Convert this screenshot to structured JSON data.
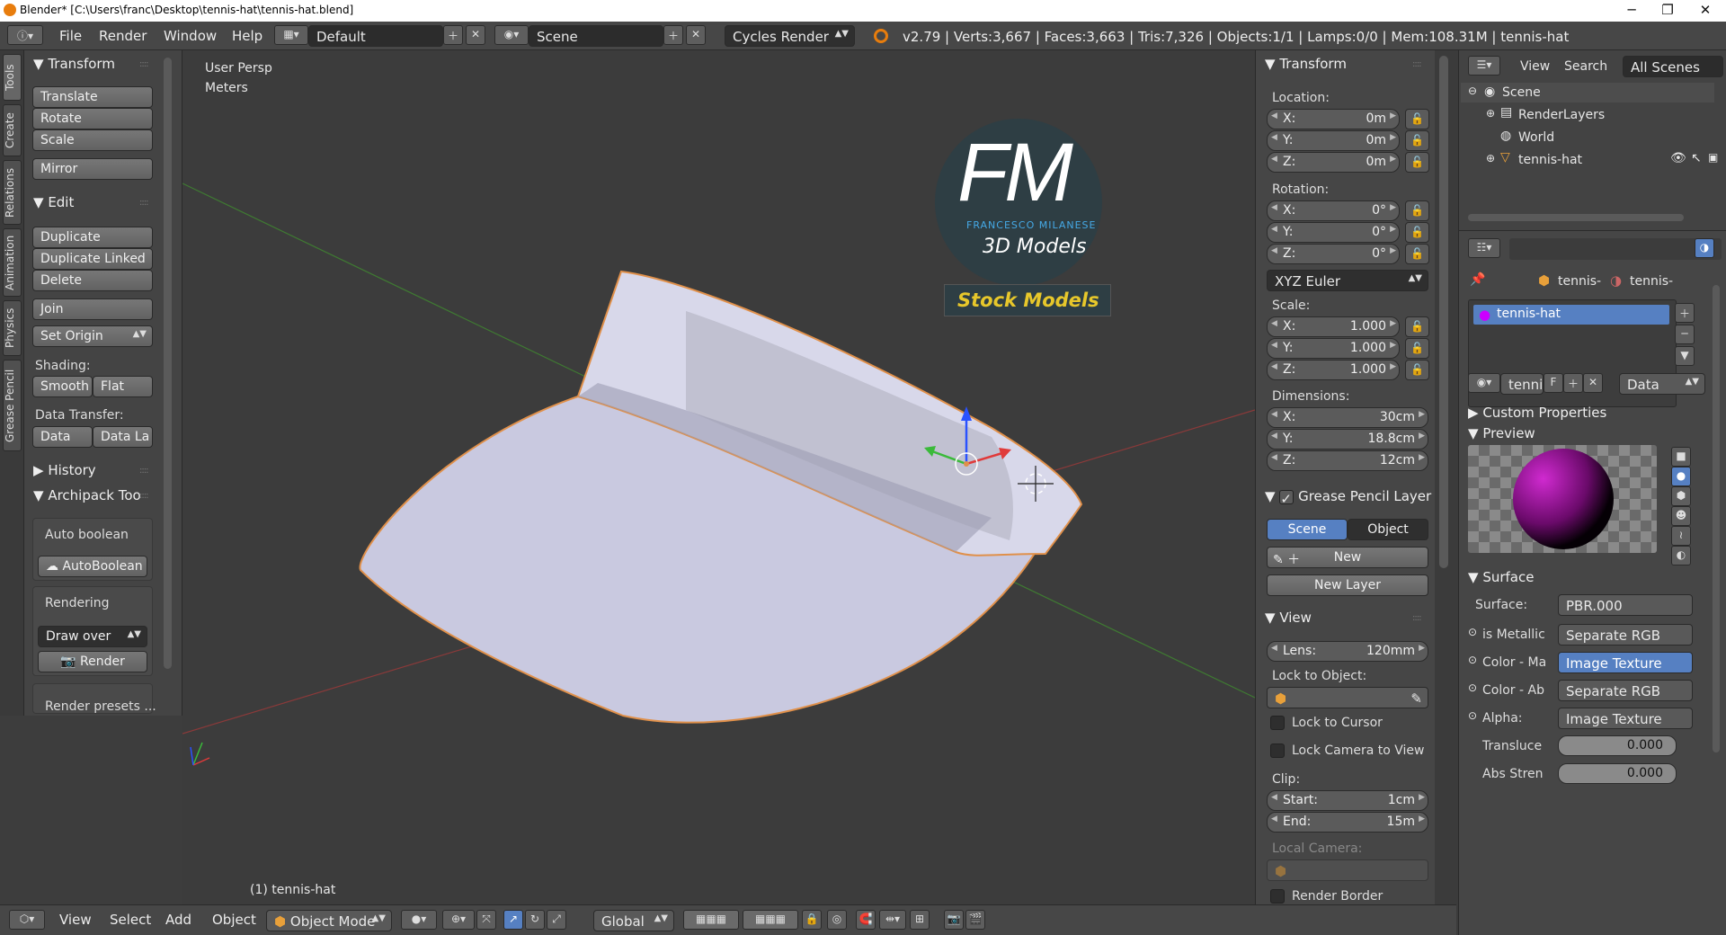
{
  "window": {
    "title": "Blender* [C:\\Users\\franc\\Desktop\\tennis-hat\\tennis-hat.blend]",
    "minimize": "─",
    "maximize": "❐",
    "close": "✕"
  },
  "infobar": {
    "menus": [
      "File",
      "Render",
      "Window",
      "Help"
    ],
    "layout": "Default",
    "scene": "Scene",
    "engine": "Cycles Render",
    "stats": "v2.79 | Verts:3,667 | Faces:3,663 | Tris:7,326 | Objects:1/1 | Lamps:0/0 | Mem:108.31M | tennis-hat"
  },
  "tool_tabs": [
    "Tools",
    "Create",
    "Relations",
    "Animation",
    "Physics",
    "Grease Pencil"
  ],
  "toolshelf": {
    "transform": {
      "title": "Transform",
      "buttons": [
        "Translate",
        "Rotate",
        "Scale",
        "Mirror"
      ]
    },
    "edit": {
      "title": "Edit",
      "buttons": [
        "Duplicate",
        "Duplicate Linked",
        "Delete",
        "Join"
      ],
      "set_origin": "Set Origin",
      "shading_label": "Shading:",
      "smooth": "Smooth",
      "flat": "Flat",
      "data_transfer_label": "Data Transfer:",
      "data": "Data",
      "data_la": "Data La"
    },
    "history": {
      "title": "History"
    },
    "archipack": {
      "title": "Archipack Too",
      "auto_boolean_label": "Auto boolean",
      "auto_boolean_btn": "AutoBoolean",
      "rendering_label": "Rendering",
      "draw_over": "Draw over",
      "render_btn": "Render",
      "render_presets": "Render presets ..."
    }
  },
  "viewport": {
    "view_name": "User Persp",
    "units": "Meters",
    "object_label": "(1) tennis-hat",
    "logo": {
      "initials": "FM",
      "name": "FRANCESCO MILANESE",
      "subtitle": "3D Models",
      "banner": "Stock Models"
    }
  },
  "npanel": {
    "transform_title": "Transform",
    "location_label": "Location:",
    "location": [
      {
        "k": "X:",
        "v": "0m"
      },
      {
        "k": "Y:",
        "v": "0m"
      },
      {
        "k": "Z:",
        "v": "0m"
      }
    ],
    "rotation_label": "Rotation:",
    "rotation": [
      {
        "k": "X:",
        "v": "0°"
      },
      {
        "k": "Y:",
        "v": "0°"
      },
      {
        "k": "Z:",
        "v": "0°"
      }
    ],
    "rotation_mode": "XYZ Euler",
    "scale_label": "Scale:",
    "scale": [
      {
        "k": "X:",
        "v": "1.000"
      },
      {
        "k": "Y:",
        "v": "1.000"
      },
      {
        "k": "Z:",
        "v": "1.000"
      }
    ],
    "dimensions_label": "Dimensions:",
    "dimensions": [
      {
        "k": "X:",
        "v": "30cm"
      },
      {
        "k": "Y:",
        "v": "18.8cm"
      },
      {
        "k": "Z:",
        "v": "12cm"
      }
    ],
    "grease_title": "Grease Pencil Layer",
    "gp_scene": "Scene",
    "gp_object": "Object",
    "gp_new": "New",
    "gp_new_layer": "New Layer",
    "view_title": "View",
    "lens_k": "Lens:",
    "lens_v": "120mm",
    "lock_to_object": "Lock to Object:",
    "lock_cursor": "Lock to Cursor",
    "lock_camera": "Lock Camera to View",
    "clip_label": "Clip:",
    "clip_start_k": "Start:",
    "clip_start_v": "1cm",
    "clip_end_k": "End:",
    "clip_end_v": "15m",
    "local_camera": "Local Camera:",
    "render_border": "Render Border"
  },
  "outliner": {
    "view": "View",
    "search": "Search",
    "filter": "All Scenes",
    "items": [
      "Scene",
      "RenderLayers",
      "World",
      "tennis-hat"
    ]
  },
  "props": {
    "crumb1": "tennis-",
    "crumb2": "tennis-",
    "material_slot": "tennis-hat",
    "mat_name": "tenni",
    "f_btn": "F",
    "data_dd": "Data",
    "custom_props": "Custom Properties",
    "preview": "Preview",
    "surface_title": "Surface",
    "surface_label": "Surface:",
    "surface_value": "PBR.000",
    "rows": [
      {
        "label": "is Metallic",
        "value": "Separate RGB"
      },
      {
        "label": "Color - Ma",
        "value": "Image Texture"
      },
      {
        "label": "Color - Ab",
        "value": "Separate RGB"
      },
      {
        "label": "Alpha:",
        "value": "Image Texture"
      }
    ],
    "translucent_label": "Transluce",
    "translucent_value": "0.000",
    "abs_label": "Abs Stren",
    "abs_value": "0.000"
  },
  "bottombar": {
    "view": "View",
    "select": "Select",
    "add": "Add",
    "object": "Object",
    "mode": "Object Mode",
    "orientation": "Global"
  },
  "colors": {
    "accent": "#5680c2",
    "object_outline": "#e0904a",
    "grid_green": "#4a8a3a",
    "grid_red": "#9a3a3a"
  },
  "icons": [
    "info-icon",
    "layout-icon",
    "scene-icon",
    "blender-logo-icon",
    "lock-icon",
    "eye-icon",
    "cursor-icon",
    "camera-icon",
    "cube-icon",
    "material-icon",
    "eyedropper-icon",
    "pencil-icon"
  ]
}
